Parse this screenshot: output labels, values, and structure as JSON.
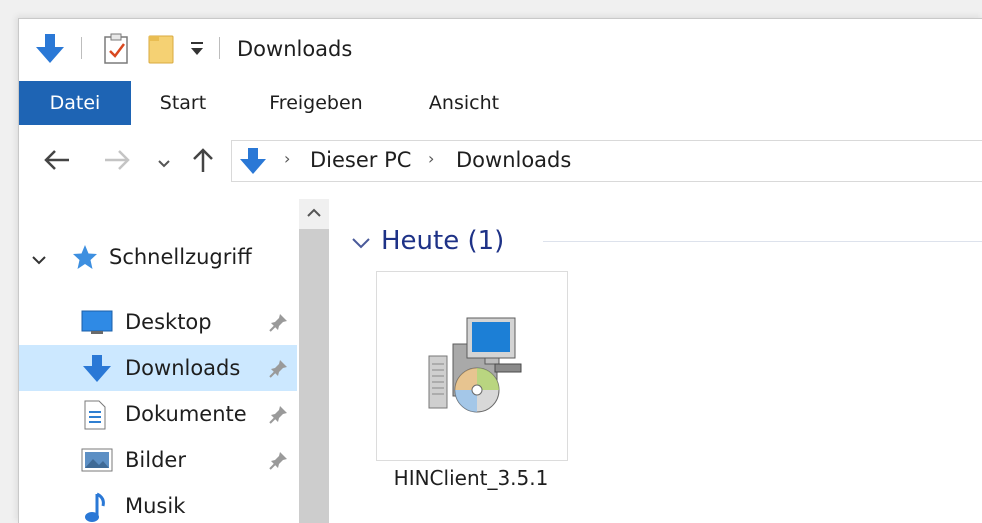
{
  "window": {
    "title": "Downloads"
  },
  "quick_access_toolbar": {
    "icons": [
      "download-arrow-icon",
      "properties-icon",
      "new-folder-icon",
      "customize-dropdown-icon"
    ]
  },
  "ribbon": {
    "tabs": [
      {
        "label": "Datei",
        "active": true
      },
      {
        "label": "Start"
      },
      {
        "label": "Freigeben"
      },
      {
        "label": "Ansicht"
      }
    ],
    "file_tab_color": "#1e64b4"
  },
  "address_bar": {
    "breadcrumbs": [
      "Dieser PC",
      "Downloads"
    ]
  },
  "sidebar": {
    "header": {
      "label": "Schnellzugriff",
      "icon": "star-icon"
    },
    "items": [
      {
        "label": "Desktop",
        "icon": "desktop-icon",
        "pinned": true
      },
      {
        "label": "Downloads",
        "icon": "downloads-icon",
        "pinned": true,
        "selected": true
      },
      {
        "label": "Dokumente",
        "icon": "documents-icon",
        "pinned": true
      },
      {
        "label": "Bilder",
        "icon": "pictures-icon",
        "pinned": true
      },
      {
        "label": "Musik",
        "icon": "music-icon",
        "pinned": false
      }
    ],
    "selected_color": "#cce8ff"
  },
  "content": {
    "groups": [
      {
        "title": "Heute (1)",
        "files": [
          {
            "name": "HINClient_3.5.1",
            "icon": "installer-icon"
          }
        ]
      }
    ]
  }
}
